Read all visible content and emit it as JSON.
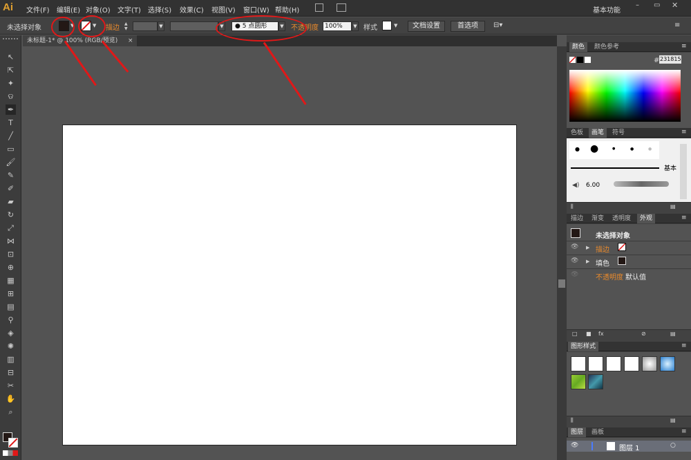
{
  "app": {
    "logo": "Ai",
    "workspace": "基本功能"
  },
  "menu": [
    "文件(F)",
    "编辑(E)",
    "对象(O)",
    "文字(T)",
    "选择(S)",
    "效果(C)",
    "视图(V)",
    "窗口(W)",
    "帮助(H)"
  ],
  "control_bar": {
    "selection_label": "未选择对象",
    "stroke_label": "描边",
    "brush_value": "5 点圆形",
    "opacity_label": "不透明度",
    "opacity_value": "100%",
    "style_label": "样式",
    "doc_setup": "文档设置",
    "preferences": "首选项"
  },
  "document_tab": {
    "title": "未标题-1* @ 100% (RGB/预览)",
    "close": "×"
  },
  "color_panel": {
    "tabs": [
      "颜色",
      "颜色参考"
    ],
    "hex_label": "#",
    "hex_value": "231815"
  },
  "brush_panel": {
    "tabs": [
      "色板",
      "画笔",
      "符号"
    ],
    "basic_label": "基本",
    "brush_size": "6.00"
  },
  "appearance_panel": {
    "tabs": [
      "描边",
      "渐变",
      "透明度",
      "外观"
    ],
    "title": "未选择对象",
    "stroke_label": "描边",
    "fill_label": "填色",
    "opacity_label": "不透明度",
    "opacity_value": "默认值"
  },
  "graphic_styles": {
    "title": "图形样式"
  },
  "layers_panel": {
    "tabs": [
      "图层",
      "画板"
    ],
    "layer_name": "图层 1"
  },
  "colors": {
    "accent_red": "#e01818",
    "orange_label": "#e98a2c",
    "fill": "#231815"
  }
}
